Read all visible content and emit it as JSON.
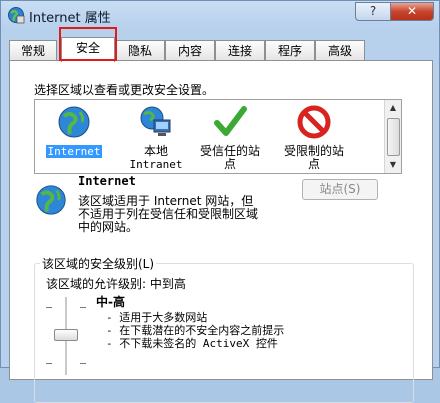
{
  "window": {
    "title": "Internet 属性",
    "help_label": "?",
    "close_label": "✕"
  },
  "tabs": [
    {
      "label": "常规"
    },
    {
      "label": "安全"
    },
    {
      "label": "隐私"
    },
    {
      "label": "内容"
    },
    {
      "label": "连接"
    },
    {
      "label": "程序"
    },
    {
      "label": "高级"
    }
  ],
  "active_tab": "安全",
  "security": {
    "zone_prompt": "选择区域以查看或更改安全设置。",
    "zones": [
      {
        "line1": "Internet",
        "line2": "",
        "icon": "globe-icon",
        "selected": true
      },
      {
        "line1": "本地",
        "line2": "Intranet",
        "icon": "intranet-icon",
        "selected": false
      },
      {
        "line1": "受信任的站",
        "line2": "点",
        "icon": "checkmark-icon",
        "selected": false
      },
      {
        "line1": "受限制的站",
        "line2": "点",
        "icon": "restricted-icon",
        "selected": false
      }
    ],
    "selected_zone": {
      "name": "Internet",
      "description_lines": [
        "该区域适用于 Internet 网站，但",
        "不适用于列在受信任和受限制区域",
        "中的网站。"
      ]
    },
    "sites_button": "站点(S)",
    "level_group_label": "该区域的安全级别(L)",
    "allowed_levels": "该区域的允许级别: 中到高",
    "level_name": "中-高",
    "level_bullets": [
      "- 适用于大多数网站",
      "- 在下载潜在的不安全内容之前提示",
      "- 不下载未签名的 ActiveX 控件"
    ]
  },
  "colors": {
    "highlight": "#e11a1a",
    "selection": "#3399ff"
  }
}
